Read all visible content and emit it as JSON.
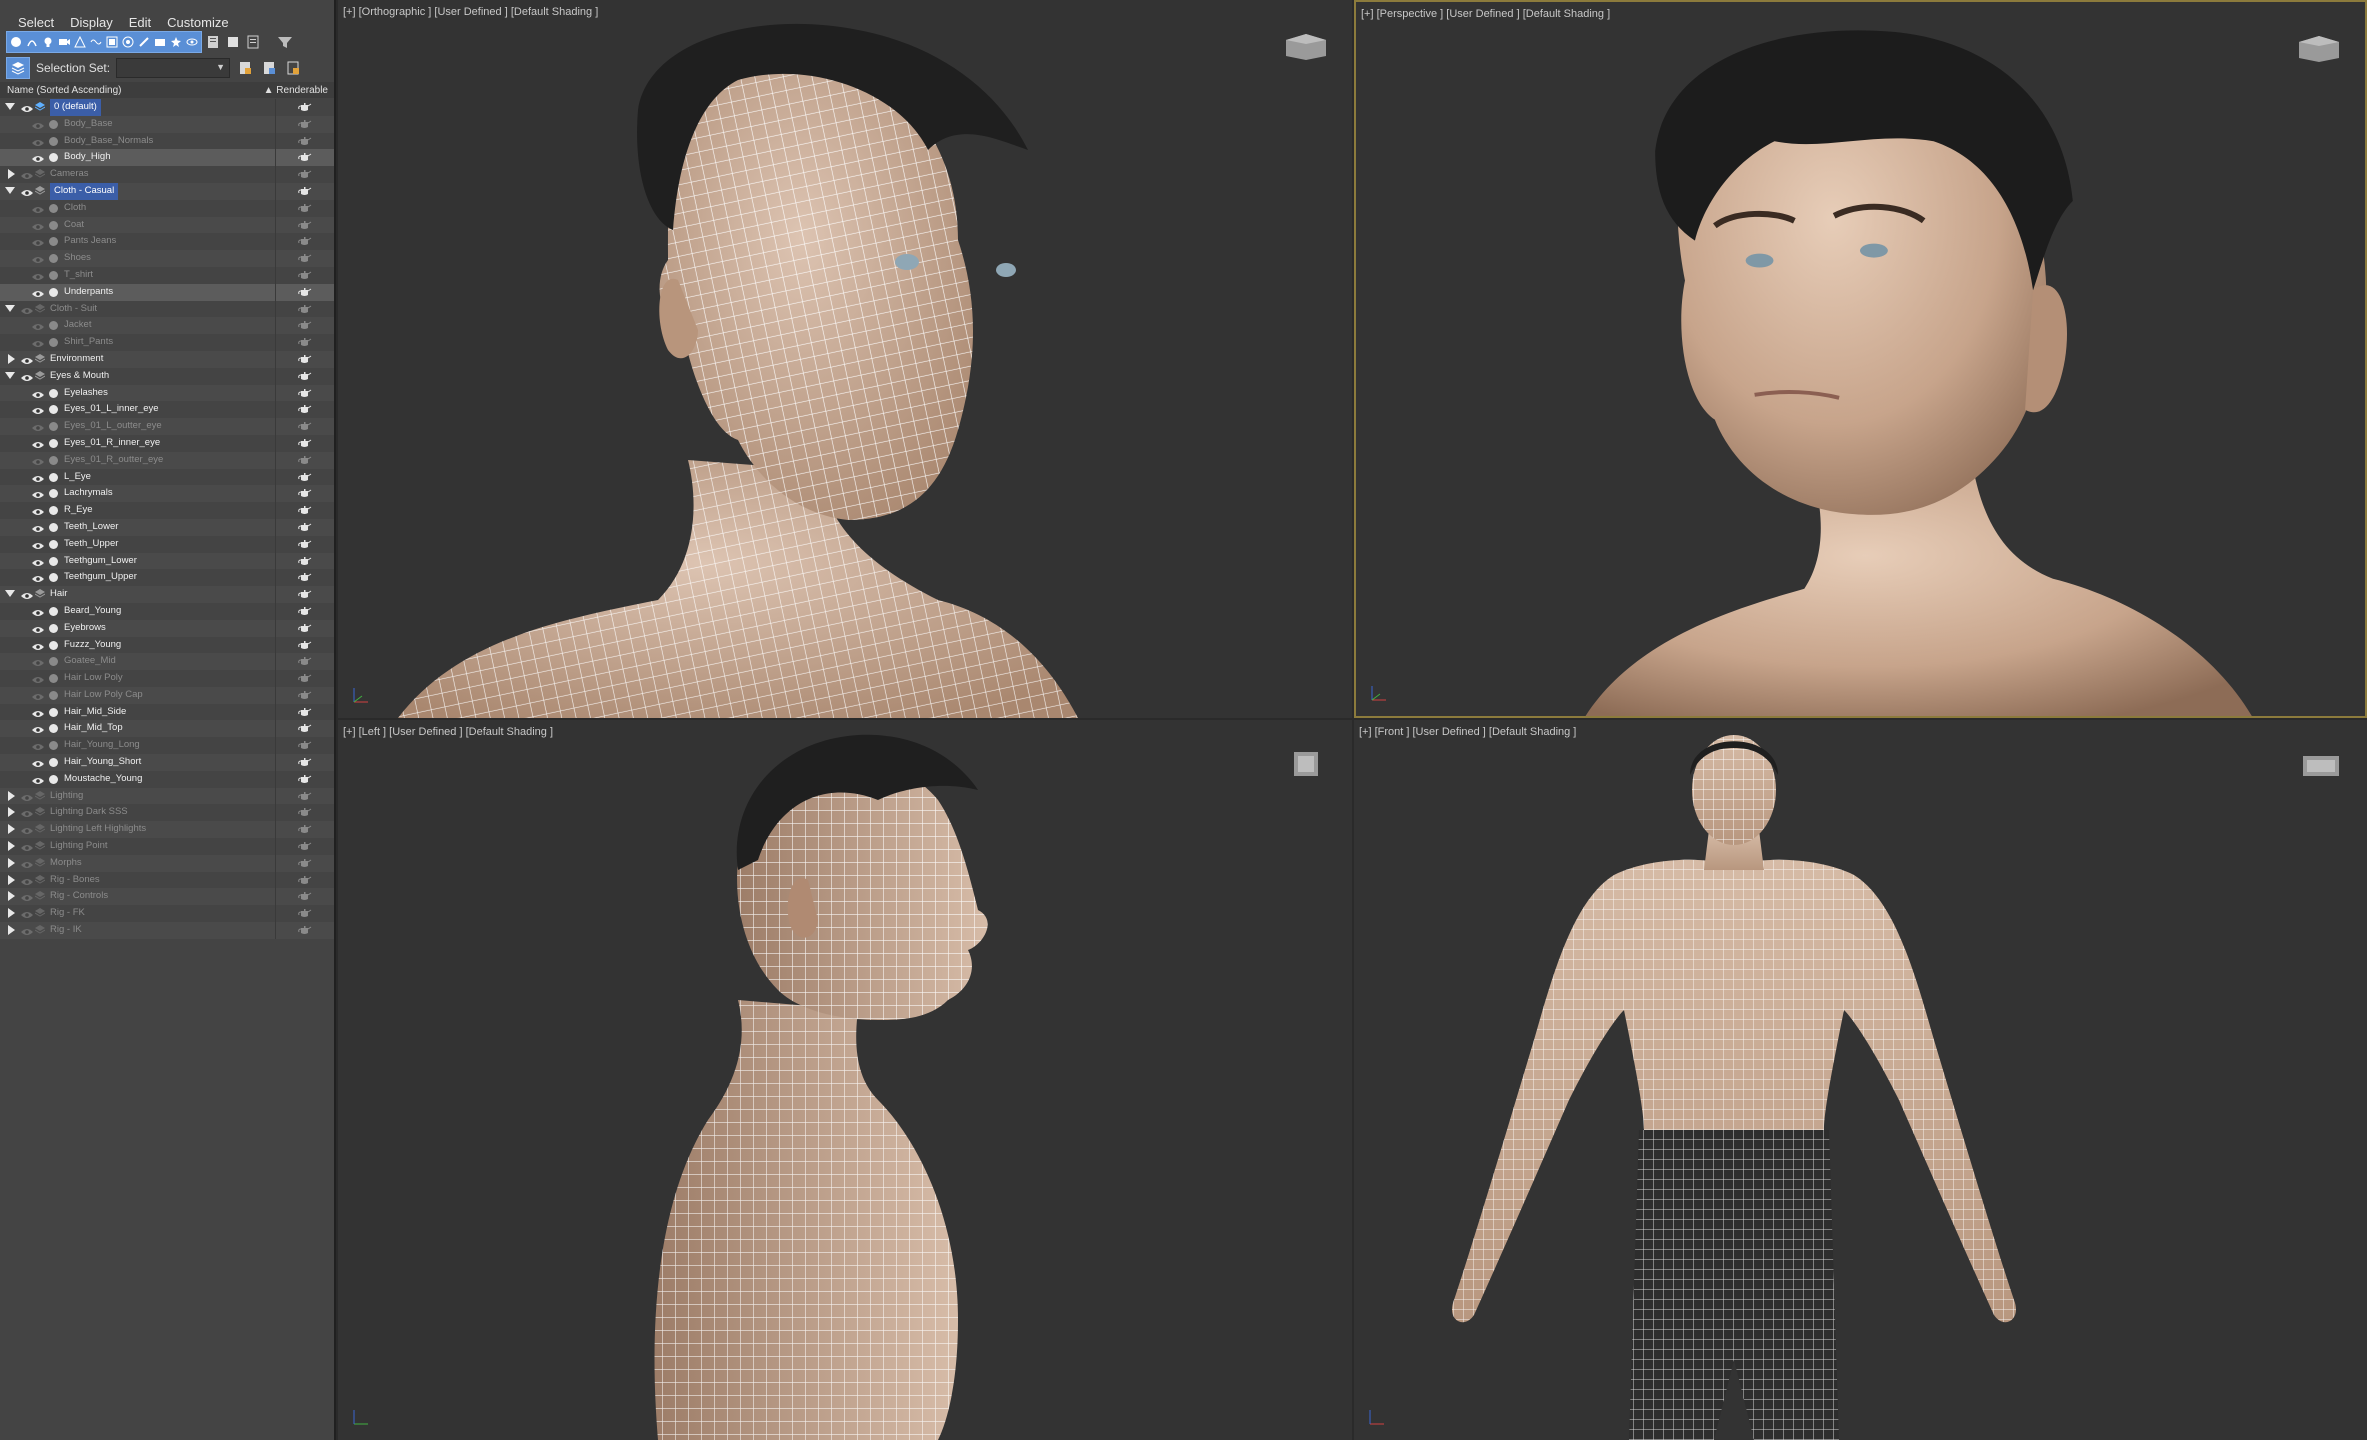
{
  "menu": [
    "Select",
    "Display",
    "Edit",
    "Customize"
  ],
  "toolbar": {
    "filter_icons": [
      "geometry-icon",
      "shape-icon",
      "light-icon",
      "camera-icon",
      "helper-icon",
      "spacewarp-icon",
      "group-icon",
      "xref-icon",
      "bone-icon",
      "container-icon",
      "frozen-icon",
      "hidden-icon"
    ],
    "selection_set_label": "Selection Set:",
    "selection_set_value": ""
  },
  "columns": {
    "name": "Name (Sorted Ascending)",
    "renderable": "▲ Renderable"
  },
  "tree": [
    {
      "label": "0 (default)",
      "indent": 0,
      "type": "layer",
      "expander": "open",
      "eye": true,
      "active": true,
      "highlight": true
    },
    {
      "label": "Body_Base",
      "indent": 1,
      "type": "object",
      "eye": false,
      "enabled": false
    },
    {
      "label": "Body_Base_Normals",
      "indent": 1,
      "type": "object",
      "eye": false,
      "enabled": false
    },
    {
      "label": "Body_High",
      "indent": 1,
      "type": "object",
      "eye": true,
      "enabled": true,
      "selected": true
    },
    {
      "label": "Cameras",
      "indent": 0,
      "type": "layer",
      "expander": "closed",
      "eye": false,
      "enabled": false
    },
    {
      "label": "Cloth - Casual",
      "indent": 0,
      "type": "layer",
      "expander": "open",
      "eye": true,
      "enabled": true,
      "highlight": true
    },
    {
      "label": "Cloth",
      "indent": 1,
      "type": "object",
      "eye": false,
      "enabled": false
    },
    {
      "label": "Coat",
      "indent": 1,
      "type": "object",
      "eye": false,
      "enabled": false
    },
    {
      "label": "Pants Jeans",
      "indent": 1,
      "type": "object",
      "eye": false,
      "enabled": false
    },
    {
      "label": "Shoes",
      "indent": 1,
      "type": "object",
      "eye": false,
      "enabled": false
    },
    {
      "label": "T_shirt",
      "indent": 1,
      "type": "object",
      "eye": false,
      "enabled": false
    },
    {
      "label": "Underpants",
      "indent": 1,
      "type": "object",
      "eye": true,
      "enabled": true,
      "selected": true
    },
    {
      "label": "Cloth - Suit",
      "indent": 0,
      "type": "layer",
      "expander": "open",
      "eye": false,
      "enabled": false
    },
    {
      "label": "Jacket",
      "indent": 1,
      "type": "object",
      "eye": false,
      "enabled": false
    },
    {
      "label": "Shirt_Pants",
      "indent": 1,
      "type": "object",
      "eye": false,
      "enabled": false
    },
    {
      "label": "Environment",
      "indent": 0,
      "type": "layer",
      "expander": "closed",
      "eye": true,
      "enabled": true
    },
    {
      "label": "Eyes & Mouth",
      "indent": 0,
      "type": "layer",
      "expander": "open",
      "eye": true,
      "enabled": true
    },
    {
      "label": "Eyelashes",
      "indent": 1,
      "type": "object",
      "eye": true,
      "enabled": true
    },
    {
      "label": "Eyes_01_L_inner_eye",
      "indent": 1,
      "type": "object",
      "eye": true,
      "enabled": true
    },
    {
      "label": "Eyes_01_L_outter_eye",
      "indent": 1,
      "type": "object",
      "eye": false,
      "enabled": false
    },
    {
      "label": "Eyes_01_R_inner_eye",
      "indent": 1,
      "type": "object",
      "eye": true,
      "enabled": true
    },
    {
      "label": "Eyes_01_R_outter_eye",
      "indent": 1,
      "type": "object",
      "eye": false,
      "enabled": false
    },
    {
      "label": "L_Eye",
      "indent": 1,
      "type": "object",
      "eye": true,
      "enabled": true
    },
    {
      "label": "Lachrymals",
      "indent": 1,
      "type": "object",
      "eye": true,
      "enabled": true
    },
    {
      "label": "R_Eye",
      "indent": 1,
      "type": "object",
      "eye": true,
      "enabled": true
    },
    {
      "label": "Teeth_Lower",
      "indent": 1,
      "type": "object",
      "eye": true,
      "enabled": true
    },
    {
      "label": "Teeth_Upper",
      "indent": 1,
      "type": "object",
      "eye": true,
      "enabled": true
    },
    {
      "label": "Teethgum_Lower",
      "indent": 1,
      "type": "object",
      "eye": true,
      "enabled": true
    },
    {
      "label": "Teethgum_Upper",
      "indent": 1,
      "type": "object",
      "eye": true,
      "enabled": true
    },
    {
      "label": "Hair",
      "indent": 0,
      "type": "layer",
      "expander": "open",
      "eye": true,
      "enabled": true
    },
    {
      "label": "Beard_Young",
      "indent": 1,
      "type": "object",
      "eye": true,
      "enabled": true
    },
    {
      "label": "Eyebrows",
      "indent": 1,
      "type": "object",
      "eye": true,
      "enabled": true
    },
    {
      "label": "Fuzzz_Young",
      "indent": 1,
      "type": "object",
      "eye": true,
      "enabled": true
    },
    {
      "label": "Goatee_Mid",
      "indent": 1,
      "type": "object",
      "eye": false,
      "enabled": false
    },
    {
      "label": "Hair Low Poly",
      "indent": 1,
      "type": "object",
      "eye": false,
      "enabled": false
    },
    {
      "label": "Hair Low Poly Cap",
      "indent": 1,
      "type": "object",
      "eye": false,
      "enabled": false
    },
    {
      "label": "Hair_Mid_Side",
      "indent": 1,
      "type": "object",
      "eye": true,
      "enabled": true
    },
    {
      "label": "Hair_Mid_Top",
      "indent": 1,
      "type": "object",
      "eye": true,
      "enabled": true
    },
    {
      "label": "Hair_Young_Long",
      "indent": 1,
      "type": "object",
      "eye": false,
      "enabled": false
    },
    {
      "label": "Hair_Young_Short",
      "indent": 1,
      "type": "object",
      "eye": true,
      "enabled": true
    },
    {
      "label": "Moustache_Young",
      "indent": 1,
      "type": "object",
      "eye": true,
      "enabled": true
    },
    {
      "label": "Lighting",
      "indent": 0,
      "type": "layer",
      "expander": "closed",
      "eye": false,
      "enabled": false
    },
    {
      "label": "Lighting Dark SSS",
      "indent": 0,
      "type": "layer",
      "expander": "closed",
      "eye": false,
      "enabled": false
    },
    {
      "label": "Lighting Left Highlights",
      "indent": 0,
      "type": "layer",
      "expander": "closed",
      "eye": false,
      "enabled": false
    },
    {
      "label": "Lighting Point",
      "indent": 0,
      "type": "layer",
      "expander": "closed",
      "eye": false,
      "enabled": false
    },
    {
      "label": "Morphs",
      "indent": 0,
      "type": "layer",
      "expander": "closed",
      "eye": false,
      "enabled": false
    },
    {
      "label": "Rig - Bones",
      "indent": 0,
      "type": "layer",
      "expander": "closed",
      "eye": false,
      "enabled": false
    },
    {
      "label": "Rig - Controls",
      "indent": 0,
      "type": "layer",
      "expander": "closed",
      "eye": false,
      "enabled": false
    },
    {
      "label": "Rig - FK",
      "indent": 0,
      "type": "layer",
      "expander": "closed",
      "eye": false,
      "enabled": false
    },
    {
      "label": "Rig - IK",
      "indent": 0,
      "type": "layer",
      "expander": "closed",
      "eye": false,
      "enabled": false
    }
  ],
  "viewports": {
    "top_left": {
      "label": "[+] [Orthographic ] [User Defined ] [Default Shading ]"
    },
    "top_right": {
      "label": "[+] [Perspective ] [User Defined ] [Default Shading ]"
    },
    "bottom_left": {
      "label": "[+] [Left ] [User Defined ] [Default Shading ]"
    },
    "bottom_right": {
      "label": "[+] [Front ] [User Defined ] [Default Shading ]"
    }
  },
  "colors": {
    "panel_bg": "#444444",
    "viewport_bg": "#333333",
    "selection_blue": "#3b5ea8",
    "active_viewport_border": "#8c7b3c",
    "skin": "#cdb29f",
    "hair": "#1e1e1e",
    "wire": "#ffffff"
  }
}
